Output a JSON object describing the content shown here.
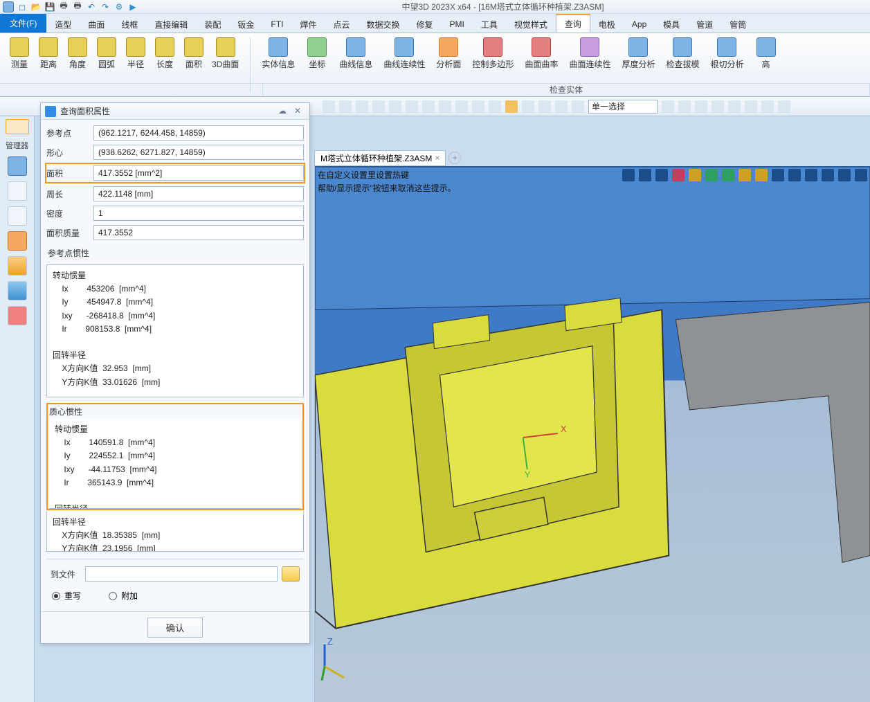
{
  "title": "中望3D 2023X x64 - [16M塔式立体循环种植架.Z3ASM]",
  "menuFile": "文件(F)",
  "menus": [
    "造型",
    "曲面",
    "线框",
    "直接编辑",
    "装配",
    "钣金",
    "FTI",
    "焊件",
    "点云",
    "数据交换",
    "修复",
    "PMI",
    "工具",
    "视觉样式",
    "查询",
    "电极",
    "App",
    "模具",
    "管道",
    "管筒"
  ],
  "menuActive": "查询",
  "ribbon": {
    "items": [
      "测量",
      "距离",
      "角度",
      "圆弧",
      "半径",
      "长度",
      "面积",
      "3D曲面"
    ],
    "items2": [
      "实体信息",
      "坐标",
      "曲线信息",
      "曲线连续性",
      "分析面",
      "控制多边形",
      "曲面曲率",
      "曲面连续性",
      "厚度分析",
      "检查拔模",
      "根切分析",
      "高"
    ],
    "group": "检查实体"
  },
  "selectMode": "单一选择",
  "managerLabel": "管理器",
  "dialog": {
    "title": "查询面积属性",
    "rows": {
      "ref": {
        "label": "参考点",
        "value": "(962.1217, 6244.458, 14859)"
      },
      "centroid": {
        "label": "形心",
        "value": "(938.6262, 6271.827, 14859)"
      },
      "area": {
        "label": "面积",
        "value": "417.3552  [mm^2]"
      },
      "perimeter": {
        "label": "周长",
        "value": "422.1148  [mm]"
      },
      "density": {
        "label": "密度",
        "value": "1"
      },
      "massArea": {
        "label": "面积质量",
        "value": "417.3552"
      }
    },
    "section1": "参考点惯性",
    "text1": "转动惯量\n    Ix        453206  [mm^4]\n    Iy        454947.8  [mm^4]\n    Ixy      -268418.8  [mm^4]\n    Ir        908153.8  [mm^4]\n\n回转半径\n    X方向K值  32.953  [mm]\n    Y方向K值  33.01626  [mm]",
    "section2": "质心惯性",
    "text2": "转动惯量\n    Ix        140591.8  [mm^4]\n    Iy        224552.1  [mm^4]\n    Ixy      -44.11753  [mm^4]\n    Ir        365143.9  [mm^4]\n\n回转半径\n    X方向K值  18.35385  [mm]\n    Y方向K值  23.1956  [mm]",
    "toFile": "到文件",
    "radio1": "重写",
    "radio2": "附加",
    "ok": "确认"
  },
  "tab": "M塔式立体循环种植架.Z3ASM",
  "hint1": "在自定义设置里设置热键",
  "hint2": "帮助/显示提示\"按钮来取消这些提示。",
  "axisX": "X",
  "axisY": "Y",
  "axisZ": "Z"
}
